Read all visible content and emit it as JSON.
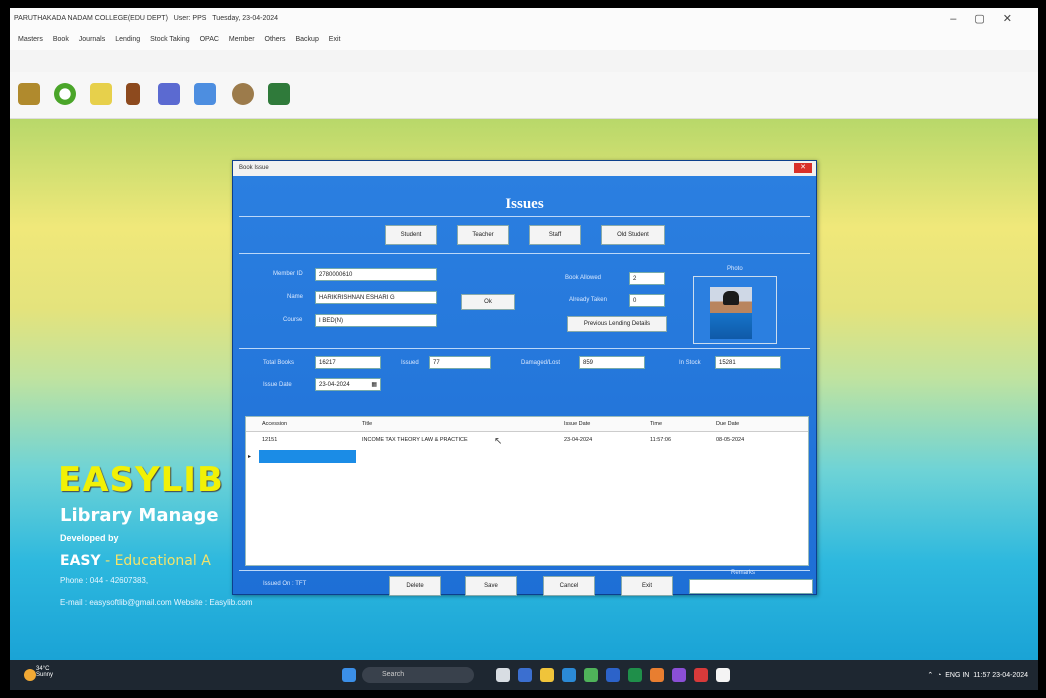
{
  "titlebar": {
    "title": "PARUTHAKADA NADAM COLLEGE(EDU DEPT)",
    "user": "User: PPS",
    "date": "Tuesday, 23-04-2024"
  },
  "menu": [
    "Masters",
    "Book",
    "Journals",
    "Lending",
    "Stock Taking",
    "OPAC",
    "Member",
    "Others",
    "Backup",
    "Exit"
  ],
  "brand": {
    "title": "EASYLIB",
    "subtitle": "Library Manage",
    "developed_by": "Developed by",
    "easy": "EASY",
    "easy_rest": " - Educational A",
    "phone": "Phone : 044 - 42607383, ",
    "email": "E-mail : easysoftlib@gmail.com     Website : Easylib.com"
  },
  "dialog": {
    "title": "Book Issue",
    "heading": "Issues",
    "member_types": [
      "Student",
      "Teacher",
      "Staff",
      "Old Student"
    ],
    "member_id_label": "Member ID",
    "member_id": "2780000610",
    "name_label": "Name",
    "name": "HARIKRISHNAN ESHARI G",
    "course_label": "Course",
    "course": "I BED(N)",
    "ok_label": "Ok",
    "book_allowed_label": "Book Allowed",
    "book_allowed": "2",
    "already_taken_label": "Already Taken",
    "already_taken": "0",
    "previous_label": "Previous Lending Details",
    "photo_label": "Photo",
    "total_books_label": "Total Books",
    "total_books": "16217",
    "issued_label": "Issued",
    "issued": "77",
    "damaged_label": "Damaged/Lost",
    "damaged": "859",
    "instock_label": "In Stock",
    "instock": "15281",
    "issue_date_label": "Issue Date",
    "issue_date": "23-04-2024",
    "grid_columns": [
      "Accession",
      "Title",
      "Issue Date",
      "Time",
      "Due Date"
    ],
    "grid_rows": [
      {
        "accession": "12151",
        "title": "INCOME TAX THEORY LAW & PRACTICE",
        "issue_date": "23-04-2024",
        "time": "11:57:06",
        "due_date": "08-05-2024"
      }
    ],
    "issued_on_label": "Issued On",
    "issued_on": "TFT",
    "buttons": [
      "Delete",
      "Save",
      "Cancel",
      "Exit"
    ],
    "remarks_label": "Remarks"
  },
  "taskbar": {
    "weather_temp": "34°C",
    "weather_desc": "Sunny",
    "search_placeholder": "Search",
    "lang": "ENG IN",
    "time": "11:57",
    "date": "23-04-2024"
  }
}
